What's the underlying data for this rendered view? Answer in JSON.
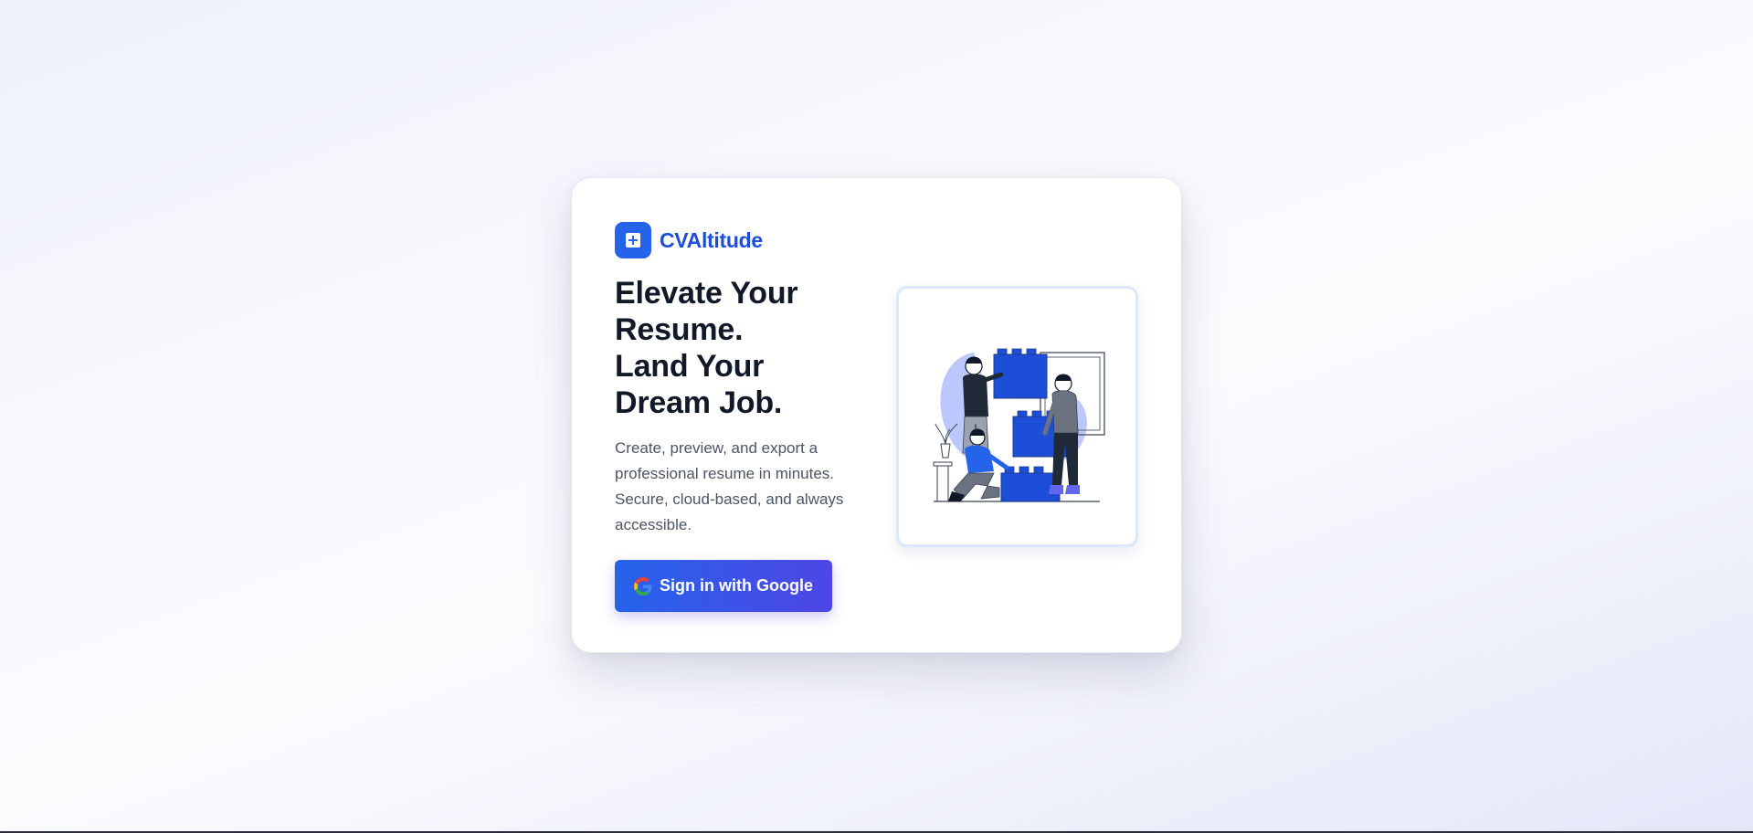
{
  "brand": {
    "name": "CVAltitude",
    "logo_icon": "plus-square-icon",
    "accent_color": "#2563eb"
  },
  "hero": {
    "headline_lines": [
      "Elevate Your",
      "Resume.",
      "Land Your",
      "Dream Job."
    ],
    "subtext": "Create, preview, and export a professional resume in minutes. Secure, cloud-based, and always accessible."
  },
  "auth": {
    "google_button_label": "Sign in with Google",
    "google_icon": "google-g-icon"
  },
  "illustration": {
    "subject": "team-stacking-boxes-illustration"
  },
  "colors": {
    "headline": "#111827",
    "subtext": "#4b5563",
    "button_gradient_start": "#2563eb",
    "button_gradient_end": "#4f46e5",
    "illustration_blue": "#1d4ed8",
    "illustration_lavender": "#a5b4fc"
  }
}
